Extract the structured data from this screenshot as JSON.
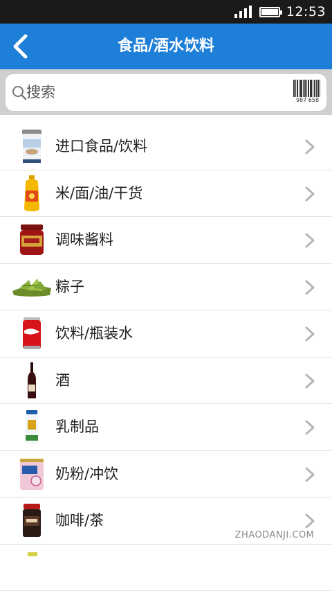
{
  "status_bar": {
    "time": "12:53",
    "signal_level": 4,
    "battery_level": 0.9,
    "icons": [
      "signal-icon",
      "battery-icon"
    ]
  },
  "app_bar": {
    "title": "食品/酒水饮料",
    "back_icon": "chevron-left-icon",
    "color": "#1e7fd8"
  },
  "search": {
    "placeholder": "搜索",
    "scan_icon": "barcode-icon",
    "barcode_digits": "987 658"
  },
  "categories": [
    {
      "label": "进口食品/饮料",
      "image": "imported-food-can"
    },
    {
      "label": "米/面/油/干货",
      "image": "cooking-oil-bottle"
    },
    {
      "label": "调味酱料",
      "image": "sauce-jar"
    },
    {
      "label": "粽子",
      "image": "zongzi"
    },
    {
      "label": "饮料/瓶装水",
      "image": "cola-can"
    },
    {
      "label": "酒",
      "image": "wine-bottle"
    },
    {
      "label": "乳制品",
      "image": "milk-carton"
    },
    {
      "label": "奶粉/冲饮",
      "image": "milk-powder-can"
    },
    {
      "label": "咖啡/茶",
      "image": "coffee-jar"
    }
  ],
  "row_chevron_icon": "chevron-right-icon",
  "watermark": "ZHAODANJI.COM"
}
